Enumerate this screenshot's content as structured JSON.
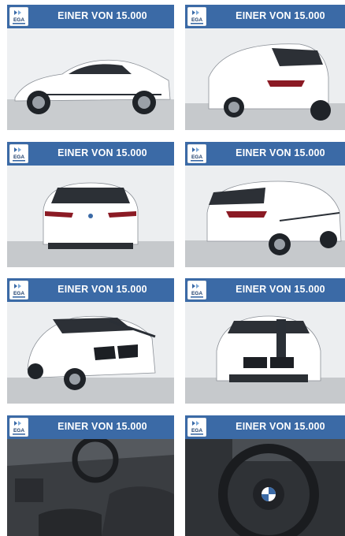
{
  "badge_text": "EINER VON 15.000",
  "logo_text": "EGA",
  "colors": {
    "banner": "#3b6aa6",
    "banner_text": "#ffffff"
  },
  "tiles": [
    {
      "photo": "car-side-view"
    },
    {
      "photo": "car-rear-three-quarter-view"
    },
    {
      "photo": "car-rear-view"
    },
    {
      "photo": "car-rear-right-three-quarter-view"
    },
    {
      "photo": "car-front-left-three-quarter-view"
    },
    {
      "photo": "car-front-view"
    },
    {
      "photo": "interior-dashboard-seats"
    },
    {
      "photo": "interior-steering-wheel"
    }
  ]
}
